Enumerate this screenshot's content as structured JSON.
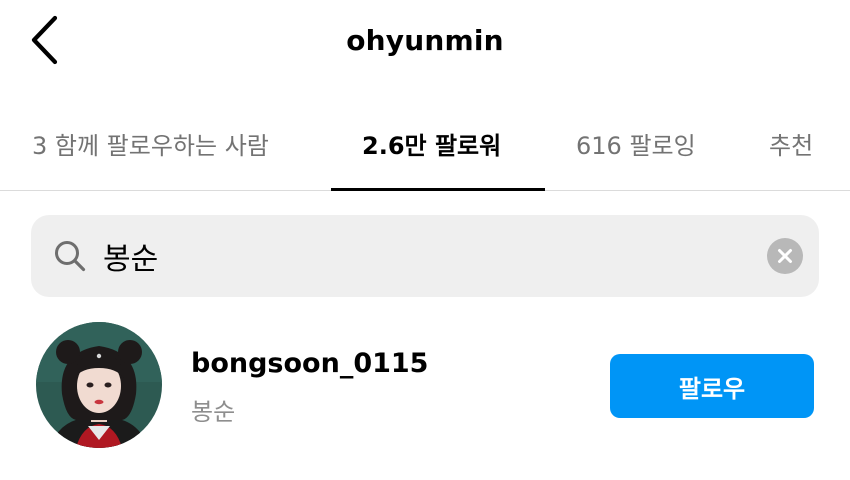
{
  "header": {
    "title": "ohyunmin",
    "back_icon": "chevron-left-icon"
  },
  "tabs": [
    {
      "label": "3 함께 팔로우하는 사람",
      "active": false
    },
    {
      "label": "2.6만 팔로워",
      "active": true
    },
    {
      "label": "616 팔로잉",
      "active": false
    },
    {
      "label": "추천",
      "active": false
    }
  ],
  "search": {
    "value": "봉순",
    "icon": "search-icon",
    "clear_icon": "clear-icon"
  },
  "results": [
    {
      "username": "bongsoon_0115",
      "full_name": "봉순",
      "follow_label": "팔로우"
    }
  ],
  "colors": {
    "accent": "#0095f6",
    "muted_text": "#737373",
    "search_bg": "#efefef",
    "divider": "#dbdbdb"
  }
}
